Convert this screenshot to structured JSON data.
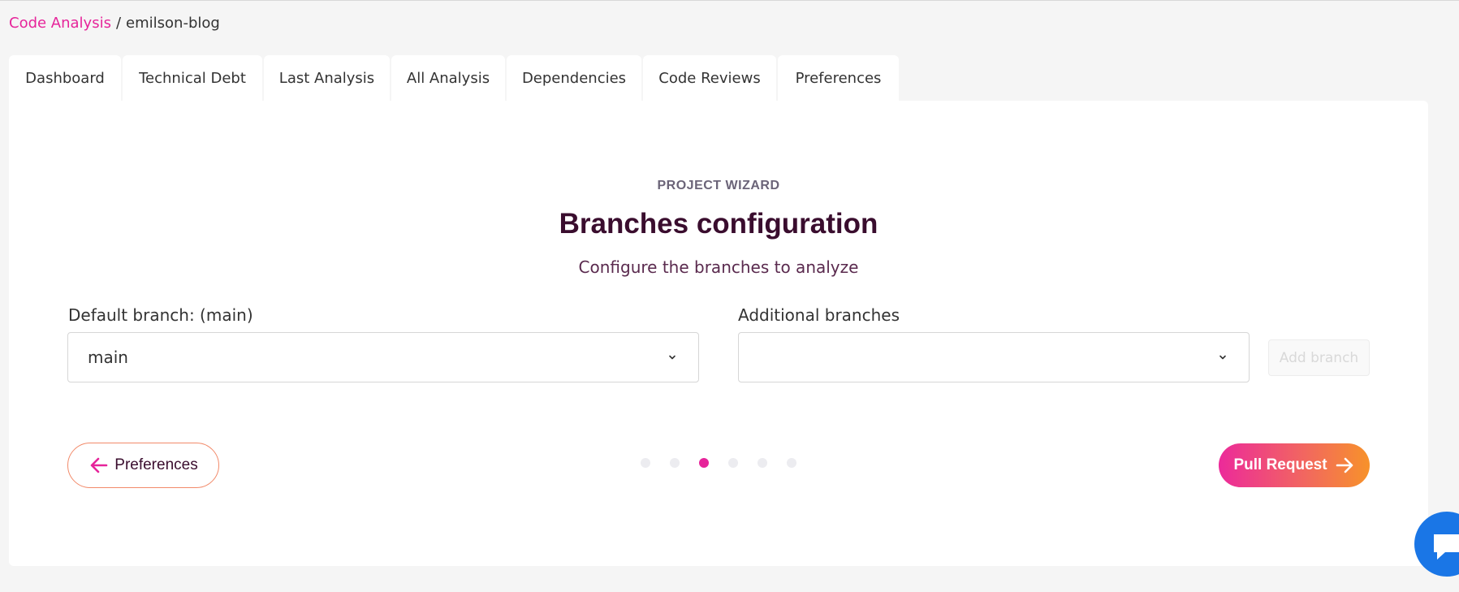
{
  "breadcrumb": {
    "parent": "Code Analysis",
    "separator": "/",
    "current": "emilson-blog"
  },
  "tabs": [
    {
      "label": "Dashboard"
    },
    {
      "label": "Technical Debt"
    },
    {
      "label": "Last Analysis"
    },
    {
      "label": "All Analysis"
    },
    {
      "label": "Dependencies"
    },
    {
      "label": "Code Reviews"
    },
    {
      "label": "Preferences"
    }
  ],
  "wizard": {
    "eyebrow": "PROJECT WIZARD",
    "title": "Branches configuration",
    "subtitle": "Configure the branches to analyze",
    "default_branch": {
      "label": "Default branch: (main)",
      "value": "main"
    },
    "additional_branches": {
      "label": "Additional branches",
      "value": ""
    },
    "add_branch_label": "Add branch",
    "prev_label": "Preferences",
    "next_label": "Pull Request",
    "steps": {
      "total": 6,
      "current": 3
    }
  },
  "colors": {
    "accent": "#e6249a",
    "gradient_end": "#f7922a",
    "title": "#3a0d2e",
    "chat": "#1a76e6"
  },
  "icons": {
    "prev": "arrow-left-icon",
    "next": "arrow-right-icon",
    "select": "chevron-down-icon",
    "chat": "chat-icon"
  }
}
